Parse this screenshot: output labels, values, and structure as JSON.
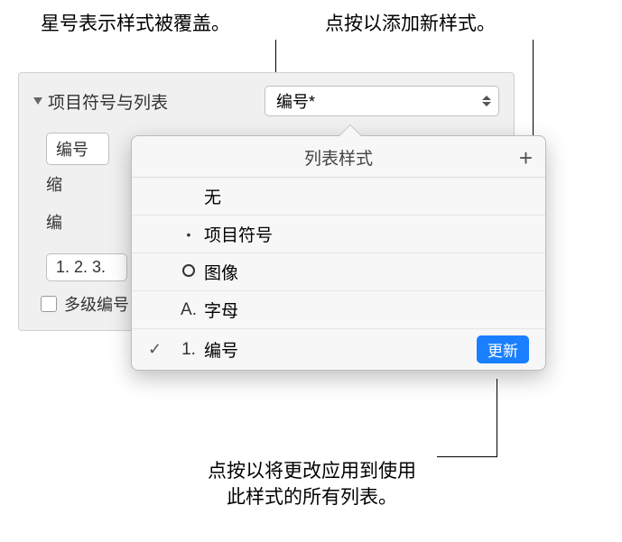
{
  "callouts": {
    "asterisk": "星号表示样式被覆盖。",
    "add": "点按以添加新样式。",
    "update_line1": "点按以将更改应用到使用",
    "update_line2": "此样式的所有列表。"
  },
  "panel": {
    "section_title": "项目符号与列表",
    "style_value": "编号*",
    "numbered_label": "编号",
    "indent_label": "缩",
    "numbered_label2": "编",
    "preview": "1. 2. 3.",
    "multilevel": "多级编号"
  },
  "popover": {
    "title": "列表样式",
    "add_symbol": "+",
    "items": [
      {
        "prefix": "",
        "label": "无",
        "checked": false
      },
      {
        "prefix": "•",
        "label": "项目符号",
        "checked": false
      },
      {
        "prefix": "circle",
        "label": "图像",
        "checked": false
      },
      {
        "prefix": "A.",
        "label": "字母",
        "checked": false
      },
      {
        "prefix": "1.",
        "label": "编号",
        "checked": true
      }
    ],
    "update_button": "更新"
  }
}
